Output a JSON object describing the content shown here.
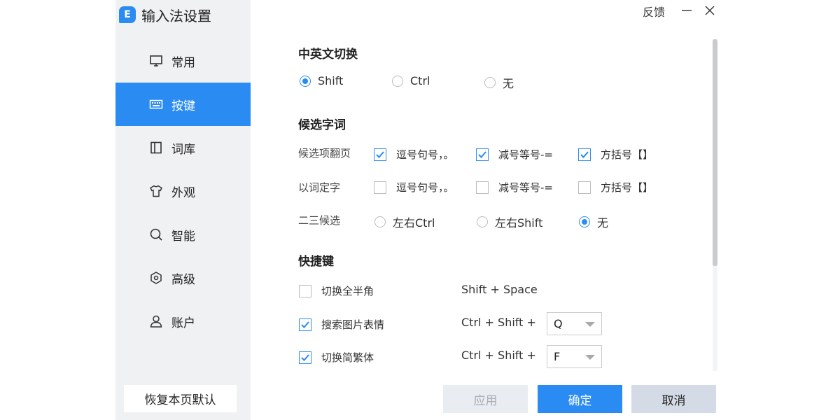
{
  "app": {
    "title": "输入法设置",
    "logo_text": "E"
  },
  "titlebar": {
    "feedback": "反馈"
  },
  "sidebar": {
    "items": [
      {
        "label": "常用",
        "icon": "monitor-icon"
      },
      {
        "label": "按键",
        "icon": "keyboard-icon",
        "active": true
      },
      {
        "label": "词库",
        "icon": "book-icon"
      },
      {
        "label": "外观",
        "icon": "shirt-icon"
      },
      {
        "label": "智能",
        "icon": "search-icon"
      },
      {
        "label": "高级",
        "icon": "hexagon-gear-icon"
      },
      {
        "label": "账户",
        "icon": "user-icon"
      }
    ],
    "reset_label": "恢复本页默认"
  },
  "switch_section": {
    "title": "中英文切换",
    "options": [
      "Shift",
      "Ctrl",
      "无"
    ],
    "selected": "Shift"
  },
  "candidate_section": {
    "title": "候选字词",
    "paging": {
      "label": "候选项翻页",
      "options": [
        {
          "label": "逗号句号，。",
          "checked": true
        },
        {
          "label": "减号等号-=",
          "checked": true
        },
        {
          "label": "方括号【】",
          "checked": true
        }
      ]
    },
    "word_to_char": {
      "label": "以词定字",
      "options": [
        {
          "label": "逗号句号，。",
          "checked": false
        },
        {
          "label": "减号等号-=",
          "checked": false
        },
        {
          "label": "方括号【】",
          "checked": false
        }
      ]
    },
    "second_third": {
      "label": "二三候选",
      "options": [
        "左右Ctrl",
        "左右Shift",
        "无"
      ],
      "selected": "无"
    }
  },
  "hotkey_section": {
    "title": "快捷键",
    "rows": [
      {
        "label": "切换全半角",
        "checked": false,
        "shortcut": "Shift + Space",
        "key": null
      },
      {
        "label": "搜索图片表情",
        "checked": true,
        "shortcut": "Ctrl + Shift +",
        "key": "Q"
      },
      {
        "label": "切换简繁体",
        "checked": true,
        "shortcut": "Ctrl + Shift +",
        "key": "F"
      }
    ]
  },
  "footer": {
    "apply": "应用",
    "ok": "确定",
    "cancel": "取消"
  },
  "colors": {
    "accent": "#2a8bf2",
    "sidebar_bg": "#f0f1f3",
    "apply_bg": "#e9ecf1",
    "cancel_bg": "#d5dbe6"
  }
}
